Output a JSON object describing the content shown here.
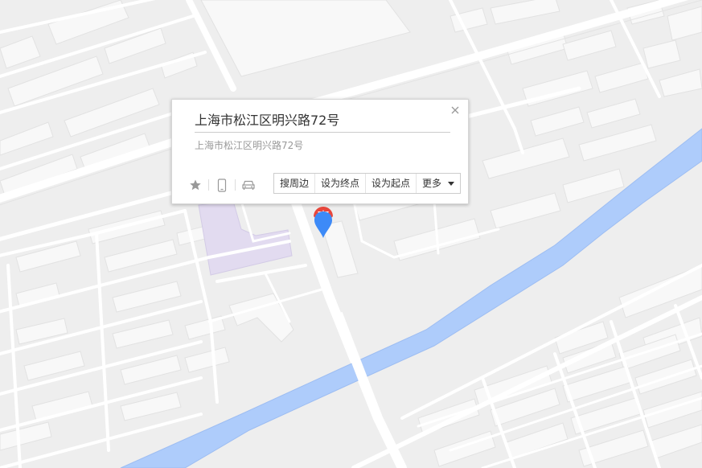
{
  "popup": {
    "title": "上海市松江区明兴路72号",
    "address": "上海市松江区明兴路72号",
    "actions": {
      "nearby": "搜周边",
      "set_destination": "设为终点",
      "set_origin": "设为起点",
      "more": "更多"
    },
    "icons": [
      "star-icon",
      "phone-icon",
      "car-icon",
      "close-icon"
    ]
  },
  "colors": {
    "map_background": "#eeeeee",
    "river": "#aeccfb",
    "road": "#ffffff",
    "building": "#f7f7f7",
    "highlight_area": "#e0d9ee",
    "marker_blue": "#3d8af7",
    "marker_red": "#e8473c"
  },
  "marker": {
    "icon": "location-pin-icon"
  }
}
